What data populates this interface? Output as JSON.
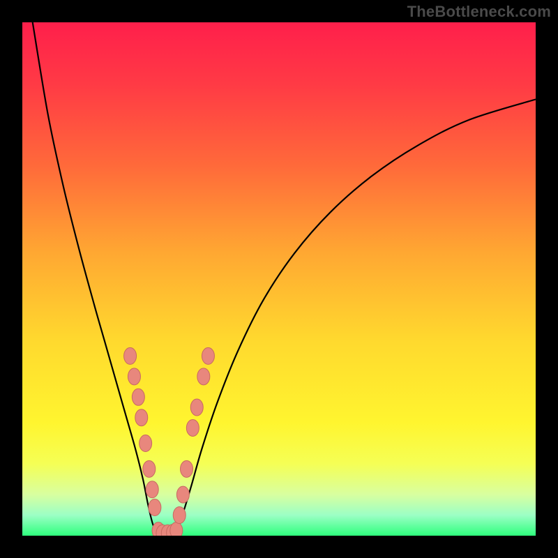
{
  "watermark": "TheBottleneck.com",
  "chart_data": {
    "type": "line",
    "title": "",
    "xlabel": "",
    "ylabel": "",
    "xlim": [
      0,
      100
    ],
    "ylim": [
      0,
      100
    ],
    "grid": false,
    "legend": false,
    "background_gradient": {
      "stops": [
        {
          "offset": 0.0,
          "color": "#ff1f4b"
        },
        {
          "offset": 0.12,
          "color": "#ff3a45"
        },
        {
          "offset": 0.28,
          "color": "#ff6a3a"
        },
        {
          "offset": 0.45,
          "color": "#ffa832"
        },
        {
          "offset": 0.62,
          "color": "#ffd92e"
        },
        {
          "offset": 0.78,
          "color": "#fff52f"
        },
        {
          "offset": 0.86,
          "color": "#f5ff55"
        },
        {
          "offset": 0.92,
          "color": "#d8ffa0"
        },
        {
          "offset": 0.96,
          "color": "#9cffc5"
        },
        {
          "offset": 1.0,
          "color": "#2eff7d"
        }
      ]
    },
    "series": [
      {
        "name": "curve",
        "type": "line",
        "stroke": "#000000",
        "values": [
          {
            "x": 2.0,
            "y": 100.0
          },
          {
            "x": 5.0,
            "y": 82.0
          },
          {
            "x": 8.0,
            "y": 68.0
          },
          {
            "x": 11.0,
            "y": 56.0
          },
          {
            "x": 14.0,
            "y": 45.0
          },
          {
            "x": 16.0,
            "y": 38.0
          },
          {
            "x": 18.0,
            "y": 31.0
          },
          {
            "x": 20.0,
            "y": 24.0
          },
          {
            "x": 22.0,
            "y": 17.0
          },
          {
            "x": 23.5,
            "y": 11.0
          },
          {
            "x": 24.5,
            "y": 6.0
          },
          {
            "x": 25.5,
            "y": 2.0
          },
          {
            "x": 26.5,
            "y": 0.5
          },
          {
            "x": 28.0,
            "y": 0.0
          },
          {
            "x": 29.5,
            "y": 0.5
          },
          {
            "x": 30.5,
            "y": 2.0
          },
          {
            "x": 31.5,
            "y": 5.0
          },
          {
            "x": 33.0,
            "y": 10.0
          },
          {
            "x": 35.0,
            "y": 17.0
          },
          {
            "x": 38.0,
            "y": 26.0
          },
          {
            "x": 42.0,
            "y": 36.0
          },
          {
            "x": 47.0,
            "y": 46.0
          },
          {
            "x": 53.0,
            "y": 55.0
          },
          {
            "x": 60.0,
            "y": 63.0
          },
          {
            "x": 68.0,
            "y": 70.0
          },
          {
            "x": 77.0,
            "y": 76.0
          },
          {
            "x": 87.0,
            "y": 81.0
          },
          {
            "x": 100.0,
            "y": 85.0
          }
        ]
      },
      {
        "name": "markers",
        "type": "scatter",
        "fill": "#e8877d",
        "stroke": "#c76a60",
        "values": [
          {
            "x": 21.0,
            "y": 35.0
          },
          {
            "x": 21.8,
            "y": 31.0
          },
          {
            "x": 22.6,
            "y": 27.0
          },
          {
            "x": 23.2,
            "y": 23.0
          },
          {
            "x": 24.0,
            "y": 18.0
          },
          {
            "x": 24.7,
            "y": 13.0
          },
          {
            "x": 25.3,
            "y": 9.0
          },
          {
            "x": 25.8,
            "y": 5.5
          },
          {
            "x": 26.5,
            "y": 1.0
          },
          {
            "x": 27.3,
            "y": 0.5
          },
          {
            "x": 28.3,
            "y": 0.5
          },
          {
            "x": 29.3,
            "y": 0.6
          },
          {
            "x": 30.0,
            "y": 1.0
          },
          {
            "x": 30.6,
            "y": 4.0
          },
          {
            "x": 31.3,
            "y": 8.0
          },
          {
            "x": 32.0,
            "y": 13.0
          },
          {
            "x": 33.2,
            "y": 21.0
          },
          {
            "x": 34.0,
            "y": 25.0
          },
          {
            "x": 35.3,
            "y": 31.0
          },
          {
            "x": 36.2,
            "y": 35.0
          }
        ]
      }
    ]
  }
}
